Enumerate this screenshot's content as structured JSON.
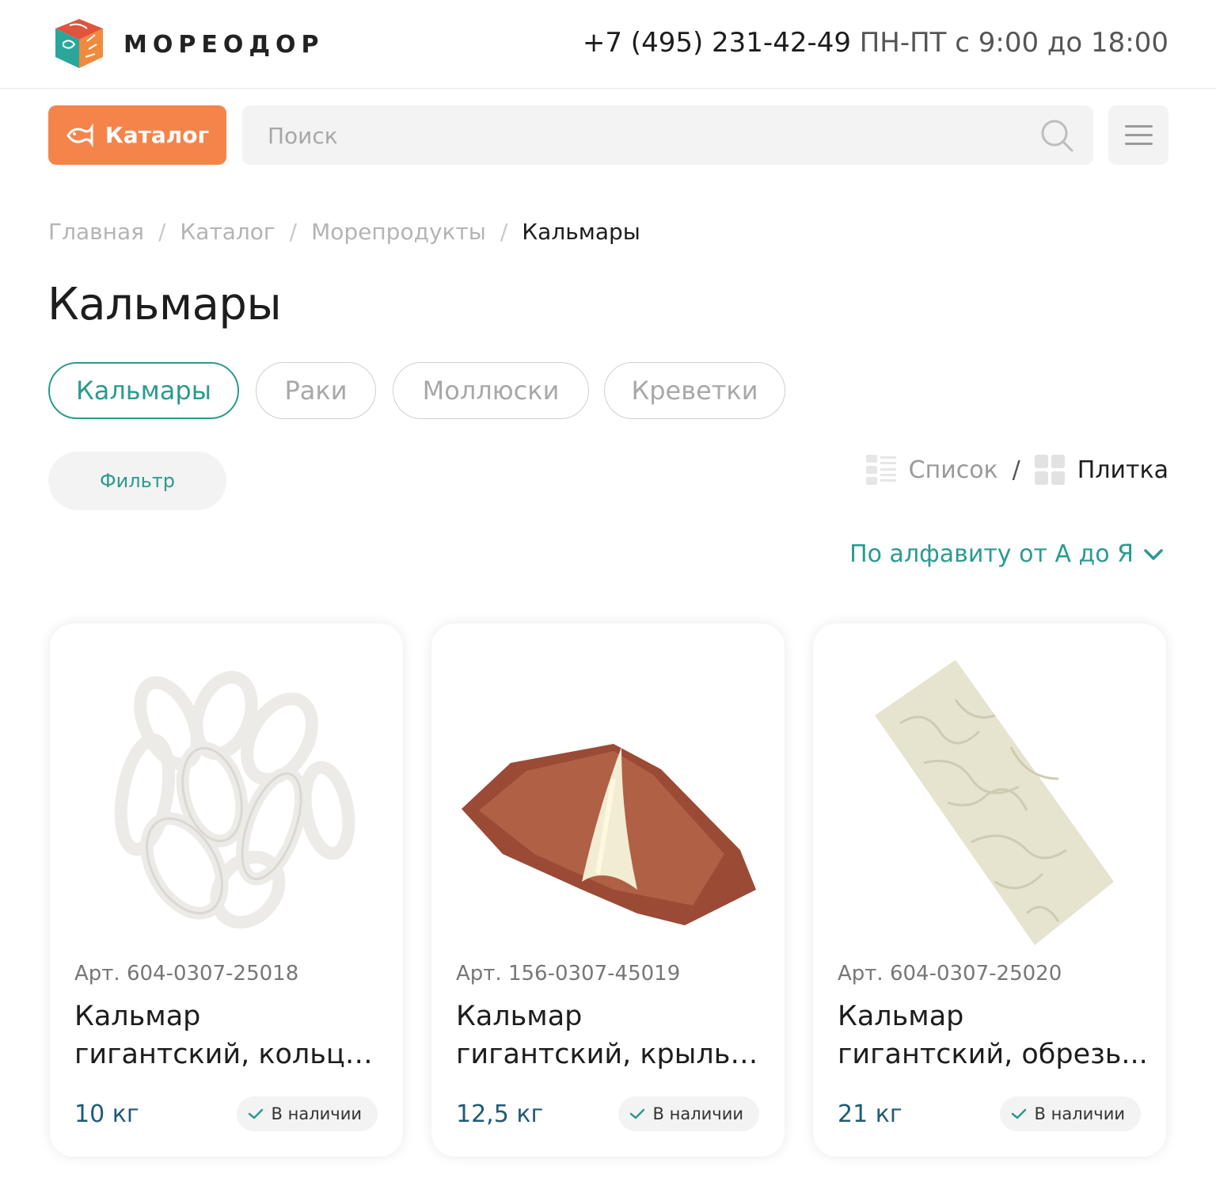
{
  "header": {
    "brand": "МОРЕОДОР",
    "phone": "+7 (495) 231-42-49",
    "hours": "ПН-ПТ с 9:00 до 18:00"
  },
  "toolbar": {
    "catalog_label": "Каталог",
    "search_placeholder": "Поиск"
  },
  "breadcrumb": [
    "Главная",
    "Каталог",
    "Морепродукты",
    "Кальмары"
  ],
  "breadcrumb_separator": "/",
  "page_title": "Кальмары",
  "categories": [
    {
      "label": "Кальмары",
      "active": true
    },
    {
      "label": "Раки",
      "active": false
    },
    {
      "label": "Моллюски",
      "active": false
    },
    {
      "label": "Креветки",
      "active": false
    }
  ],
  "filter_label": "Фильтр",
  "view": {
    "list_label": "Список",
    "separator": "/",
    "tile_label": "Плитка",
    "selected": "Плитка"
  },
  "sort_label": "По алфавиту от А до Я",
  "products": [
    {
      "sku": "Арт. 604-0307-25018",
      "name_line1": "Кальмар",
      "name_line2": "гигантский, кольца...",
      "weight": "10 кг",
      "stock": "В наличии",
      "image": "squid-rings"
    },
    {
      "sku": "Арт. 156-0307-45019",
      "name_line1": "Кальмар",
      "name_line2": "гигантский, крылья...",
      "weight": "12,5 кг",
      "stock": "В наличии",
      "image": "squid-wing"
    },
    {
      "sku": "Арт. 604-0307-25020",
      "name_line1": "Кальмар",
      "name_line2": "гигантский, обрезь...",
      "weight": "21 кг",
      "stock": "В наличии",
      "image": "squid-trimmings-block"
    }
  ],
  "colors": {
    "accent": "#2b9a90",
    "catalog_button": "#f5844a",
    "weight_text": "#1f5a76"
  }
}
